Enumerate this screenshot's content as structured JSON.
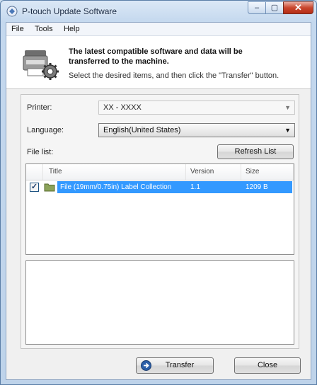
{
  "window": {
    "title": "P-touch Update Software",
    "controls": {
      "minimize": "–",
      "maximize": "▢",
      "close": "✕"
    }
  },
  "menu": {
    "items": [
      "File",
      "Tools",
      "Help"
    ]
  },
  "header": {
    "title": "The latest compatible software and data will be transferred to the machine.",
    "subtitle": "Select the desired items, and then click the \"Transfer\" button."
  },
  "form": {
    "printer_label": "Printer:",
    "printer_value": "XX - XXXX",
    "language_label": "Language:",
    "language_value": "English(United States)",
    "filelist_label": "File list:",
    "refresh_label": "Refresh List"
  },
  "list": {
    "columns": [
      "Title",
      "Version",
      "Size"
    ],
    "rows": [
      {
        "checked": true,
        "title": "File (19mm/0.75in) Label Collection",
        "version": "1.1",
        "size": "1209 B"
      }
    ]
  },
  "buttons": {
    "transfer": "Transfer",
    "close": "Close"
  },
  "colors": {
    "selection": "#3399ff",
    "close_button": "#c9462d"
  }
}
